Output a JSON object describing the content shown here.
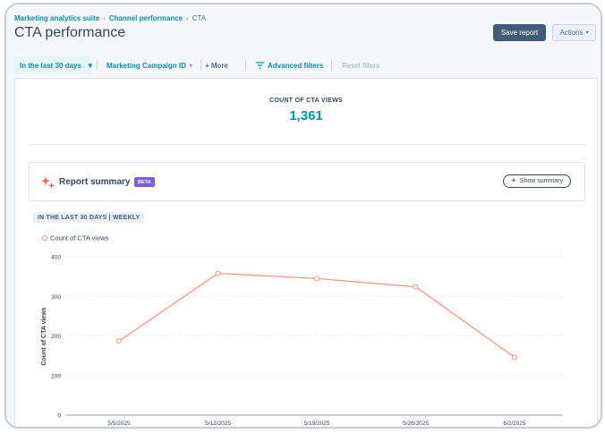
{
  "breadcrumbs": [
    "Marketing analytics suite",
    "Channel performance",
    "CTA"
  ],
  "page_title": "CTA performance",
  "buttons": {
    "save": "Save report",
    "actions": "Actions"
  },
  "filters": {
    "date_range": "In the last 30 days",
    "campaign": "Marketing Campaign ID",
    "more": "+ More",
    "advanced": "Advanced filters",
    "reset": "Reset filters"
  },
  "kpi": {
    "label": "COUNT OF CTA VIEWS",
    "value": "1,361"
  },
  "summary": {
    "title": "Report summary",
    "badge": "BETA",
    "show_label": "Show summary"
  },
  "chart_tag": "IN THE LAST 30 DAYS | WEEKLY",
  "colors": {
    "accent": "#0091ae",
    "series": "#f2917f",
    "primary_button": "#425b76",
    "beta": "#7c5fe0"
  },
  "chart_data": {
    "type": "line",
    "categories": [
      "5/5/2025",
      "5/12/2025",
      "5/19/2025",
      "5/26/2025",
      "6/2/2025"
    ],
    "series": [
      {
        "name": "Count of CTA views",
        "values": [
          187,
          358,
          345,
          324,
          146
        ]
      }
    ],
    "ylabel": "Count of CTA views",
    "xlabel": "",
    "ylim": [
      0,
      400
    ],
    "yticks": [
      0,
      100,
      200,
      300,
      400
    ],
    "grid": true,
    "legend": "top-left"
  }
}
